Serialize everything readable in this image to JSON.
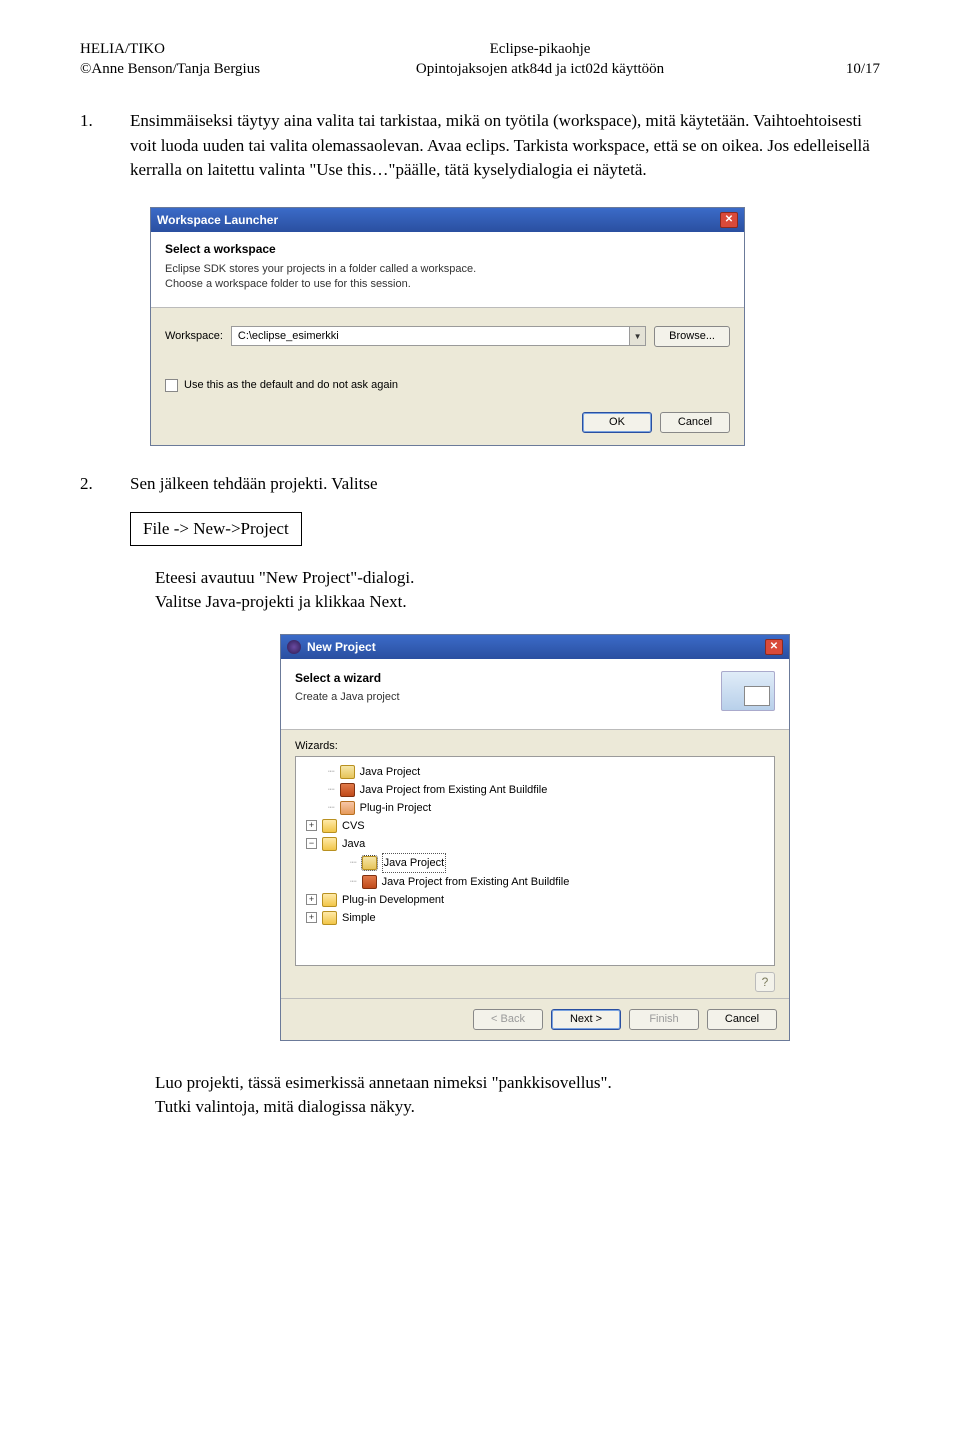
{
  "header": {
    "left_line1": "HELIA/TIKO",
    "left_line2": "©Anne Benson/Tanja Bergius",
    "center_line1": "Eclipse-pikaohje",
    "center_line2": "Opintojaksojen atk84d ja ict02d  käyttöön",
    "page_num": "10/17"
  },
  "para1": {
    "num": "1.",
    "text": "Ensimmäiseksi täytyy aina valita tai tarkistaa, mikä on työtila (workspace), mitä käytetään. Vaihtoehtoisesti voit luoda uuden tai valita olemassaolevan. Avaa eclips. Tarkista workspace, että se on oikea. Jos edelleisellä kerralla on laitettu valinta \"Use this…\"päälle, tätä kyselydialogia ei näytetä."
  },
  "workspace_launcher": {
    "title": "Workspace Launcher",
    "select_title": "Select a workspace",
    "select_sub1": "Eclipse SDK stores your projects in a folder called a workspace.",
    "select_sub2": "Choose a workspace folder to use for this session.",
    "workspace_label": "Workspace:",
    "workspace_value": "C:\\eclipse_esimerkki",
    "browse_btn": "Browse...",
    "check_label": "Use this as the default and do not ask again",
    "ok_btn": "OK",
    "cancel_btn": "Cancel"
  },
  "para2": {
    "num": "2.",
    "text": "Sen jälkeen tehdään projekti. Valitse"
  },
  "boxed_cmd": "File -> New->Project",
  "indent_lines": {
    "l1": "Eteesi avautuu \"New Project\"-dialogi.",
    "l2": "Valitse  Java-projekti ja klikkaa Next."
  },
  "new_project": {
    "title": "New Project",
    "wiz_title": "Select a wizard",
    "wiz_sub": "Create a Java project",
    "wizards_label": "Wizards:",
    "tree": {
      "java_project": "Java Project",
      "java_project_ant": "Java Project from Existing Ant Buildfile",
      "plugin_project": "Plug-in Project",
      "cvs": "CVS",
      "java": "Java",
      "java_project2": "Java Project",
      "java_project_ant2": "Java Project from Existing Ant Buildfile",
      "plugin_dev": "Plug-in Development",
      "simple": "Simple"
    },
    "back_btn": "< Back",
    "next_btn": "Next >",
    "finish_btn": "Finish",
    "cancel_btn": "Cancel"
  },
  "footer": {
    "l1": "Luo projekti, tässä esimerkissä annetaan nimeksi \"pankkisovellus\".",
    "l2": "Tutki valintoja, mitä dialogissa näkyy."
  }
}
